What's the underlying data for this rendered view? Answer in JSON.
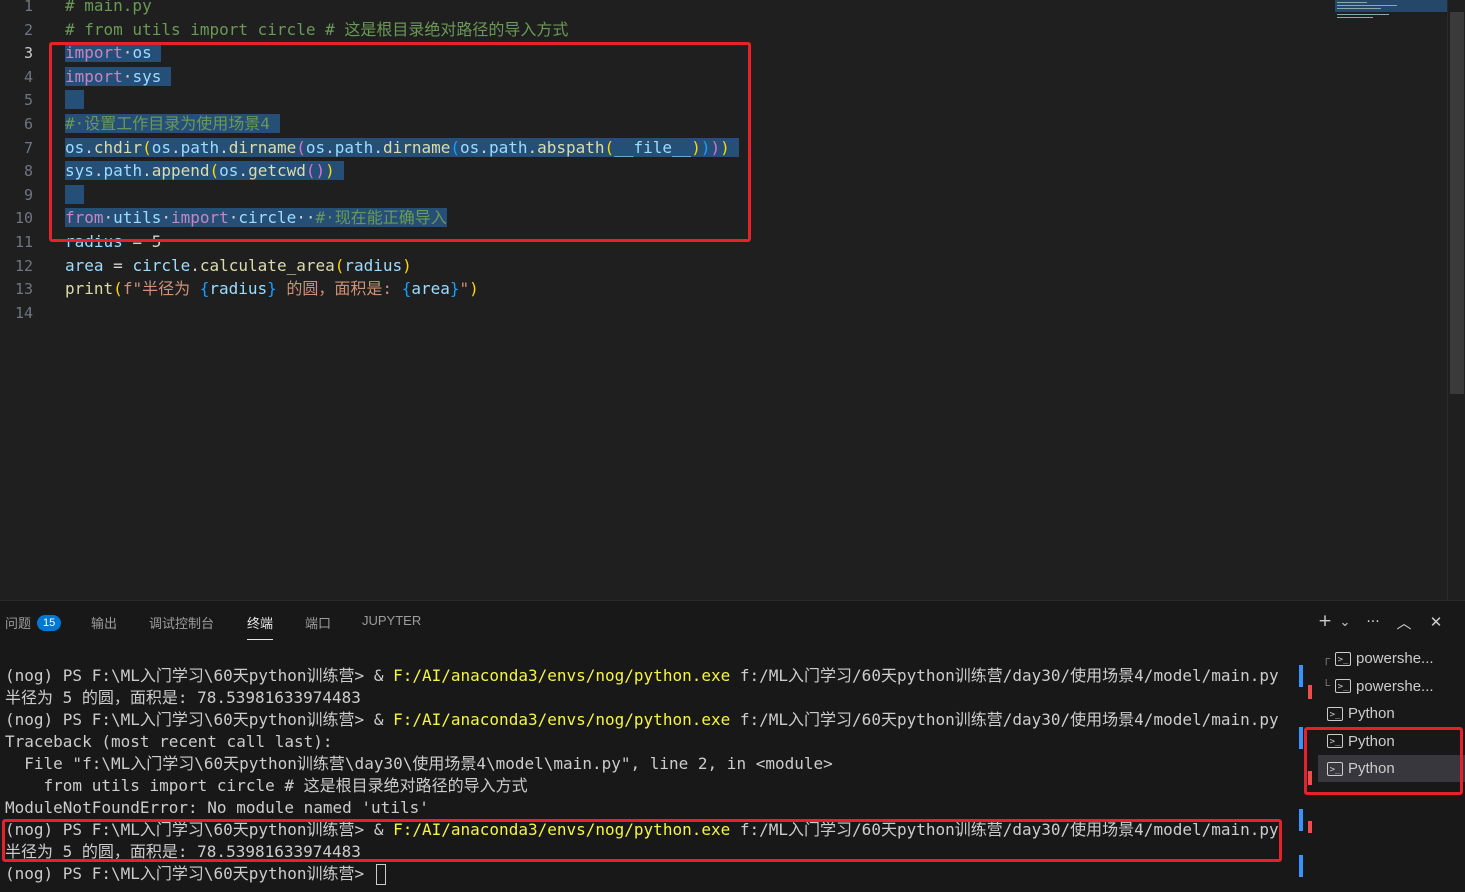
{
  "editor": {
    "lines": [
      {
        "n": "1",
        "segs": [
          {
            "t": "# main.py",
            "c": "com"
          }
        ]
      },
      {
        "n": "2",
        "segs": [
          {
            "t": "# from utils import circle # 这是根目录绝对路径的导入方式",
            "c": "com"
          }
        ]
      },
      {
        "n": "3",
        "cur": true,
        "sel": true,
        "segs": [
          {
            "t": "import",
            "c": "kw"
          },
          {
            "t": "·",
            "c": "ws"
          },
          {
            "t": "os",
            "c": "var"
          },
          {
            "t": " ",
            "c": "plain"
          }
        ]
      },
      {
        "n": "4",
        "sel": true,
        "segs": [
          {
            "t": "import",
            "c": "kw"
          },
          {
            "t": "·",
            "c": "ws"
          },
          {
            "t": "sys",
            "c": "var"
          },
          {
            "t": " ",
            "c": "plain"
          }
        ]
      },
      {
        "n": "5",
        "sel": true,
        "segs": [
          {
            "t": "  ",
            "c": "plain"
          }
        ]
      },
      {
        "n": "6",
        "sel": true,
        "segs": [
          {
            "t": "#·设置工作目录为使用场景4",
            "c": "com"
          },
          {
            "t": " ",
            "c": "plain"
          }
        ]
      },
      {
        "n": "7",
        "sel": true,
        "segs": [
          {
            "t": "os",
            "c": "var"
          },
          {
            "t": ".",
            "c": "plain"
          },
          {
            "t": "chdir",
            "c": "fn"
          },
          {
            "t": "(",
            "c": "br1"
          },
          {
            "t": "os",
            "c": "var"
          },
          {
            "t": ".",
            "c": "plain"
          },
          {
            "t": "path",
            "c": "var"
          },
          {
            "t": ".",
            "c": "plain"
          },
          {
            "t": "dirname",
            "c": "fn"
          },
          {
            "t": "(",
            "c": "br2"
          },
          {
            "t": "os",
            "c": "var"
          },
          {
            "t": ".",
            "c": "plain"
          },
          {
            "t": "path",
            "c": "var"
          },
          {
            "t": ".",
            "c": "plain"
          },
          {
            "t": "dirname",
            "c": "fn"
          },
          {
            "t": "(",
            "c": "br3"
          },
          {
            "t": "os",
            "c": "var"
          },
          {
            "t": ".",
            "c": "plain"
          },
          {
            "t": "path",
            "c": "var"
          },
          {
            "t": ".",
            "c": "plain"
          },
          {
            "t": "abspath",
            "c": "fn"
          },
          {
            "t": "(",
            "c": "br1"
          },
          {
            "t": "__file__",
            "c": "var"
          },
          {
            "t": ")",
            "c": "br1"
          },
          {
            "t": ")",
            "c": "br3"
          },
          {
            "t": ")",
            "c": "br2"
          },
          {
            "t": ")",
            "c": "br1"
          },
          {
            "t": " ",
            "c": "plain"
          }
        ]
      },
      {
        "n": "8",
        "sel": true,
        "segs": [
          {
            "t": "sys",
            "c": "var"
          },
          {
            "t": ".",
            "c": "plain"
          },
          {
            "t": "path",
            "c": "var"
          },
          {
            "t": ".",
            "c": "plain"
          },
          {
            "t": "append",
            "c": "fn"
          },
          {
            "t": "(",
            "c": "br1"
          },
          {
            "t": "os",
            "c": "var"
          },
          {
            "t": ".",
            "c": "plain"
          },
          {
            "t": "getcwd",
            "c": "fn"
          },
          {
            "t": "(",
            "c": "br2"
          },
          {
            "t": ")",
            "c": "br2"
          },
          {
            "t": ")",
            "c": "br1"
          },
          {
            "t": " ",
            "c": "plain"
          }
        ]
      },
      {
        "n": "9",
        "sel": true,
        "segs": [
          {
            "t": "  ",
            "c": "plain"
          }
        ]
      },
      {
        "n": "10",
        "sel": true,
        "segs": [
          {
            "t": "from",
            "c": "kw"
          },
          {
            "t": "·",
            "c": "ws"
          },
          {
            "t": "utils",
            "c": "var"
          },
          {
            "t": "·",
            "c": "ws"
          },
          {
            "t": "import",
            "c": "kw"
          },
          {
            "t": "·",
            "c": "ws"
          },
          {
            "t": "circle",
            "c": "var"
          },
          {
            "t": "··",
            "c": "ws"
          },
          {
            "t": "#·现在能正确导入",
            "c": "com"
          }
        ]
      },
      {
        "n": "11",
        "segs": [
          {
            "t": "radius",
            "c": "var"
          },
          {
            "t": " = ",
            "c": "plain"
          },
          {
            "t": "5",
            "c": "plain"
          }
        ]
      },
      {
        "n": "12",
        "segs": [
          {
            "t": "area",
            "c": "var"
          },
          {
            "t": " = ",
            "c": "plain"
          },
          {
            "t": "circle",
            "c": "var"
          },
          {
            "t": ".",
            "c": "plain"
          },
          {
            "t": "calculate_area",
            "c": "fn"
          },
          {
            "t": "(",
            "c": "br1"
          },
          {
            "t": "radius",
            "c": "var"
          },
          {
            "t": ")",
            "c": "br1"
          }
        ]
      },
      {
        "n": "13",
        "segs": [
          {
            "t": "print",
            "c": "fn"
          },
          {
            "t": "(",
            "c": "br1"
          },
          {
            "t": "f\"半径为 ",
            "c": "str"
          },
          {
            "t": "{",
            "c": "br3"
          },
          {
            "t": "radius",
            "c": "var"
          },
          {
            "t": "}",
            "c": "br3"
          },
          {
            "t": " 的圆，面积是: ",
            "c": "str"
          },
          {
            "t": "{",
            "c": "br3"
          },
          {
            "t": "area",
            "c": "var"
          },
          {
            "t": "}",
            "c": "br3"
          },
          {
            "t": "\"",
            "c": "str"
          },
          {
            "t": ")",
            "c": "br1"
          }
        ]
      },
      {
        "n": "14",
        "segs": []
      }
    ]
  },
  "panel": {
    "tabs": [
      {
        "label": "问题",
        "badge": "15"
      },
      {
        "label": "输出"
      },
      {
        "label": "调试控制台"
      },
      {
        "label": "终端",
        "active": true
      },
      {
        "label": "端口"
      },
      {
        "label": "JUPYTER"
      }
    ],
    "tools": {
      "add": "+",
      "dropdown": "⌄",
      "more": "···",
      "maximize": "︿",
      "close": "✕"
    },
    "terminal_lines": [
      {
        "segs": [
          {
            "t": "(nog) PS F:\\ML入门学习\\60天python训练营> & "
          },
          {
            "t": "F:/AI/anaconda3/envs/nog/python.exe",
            "c": "yel"
          },
          {
            "t": " f:/ML入门学习/60天python训练营/day30/使用场景4/model/main.py"
          }
        ]
      },
      {
        "segs": [
          {
            "t": "半径为 5 的圆，面积是: 78.53981633974483"
          }
        ]
      },
      {
        "segs": [
          {
            "t": "(nog) PS F:\\ML入门学习\\60天python训练营> & "
          },
          {
            "t": "F:/AI/anaconda3/envs/nog/python.exe",
            "c": "yel"
          },
          {
            "t": " f:/ML入门学习/60天python训练营/day30/使用场景4/model/main.py"
          }
        ]
      },
      {
        "segs": [
          {
            "t": "Traceback (most recent call last):"
          }
        ]
      },
      {
        "segs": [
          {
            "t": "  File \"f:\\ML入门学习\\60天python训练营\\day30\\使用场景4\\model\\main.py\", line 2, in <module>"
          }
        ]
      },
      {
        "segs": [
          {
            "t": "    from utils import circle # 这是根目录绝对路径的导入方式"
          }
        ]
      },
      {
        "segs": [
          {
            "t": "ModuleNotFoundError: No module named 'utils'"
          }
        ]
      },
      {
        "segs": [
          {
            "t": "(nog) PS F:\\ML入门学习\\60天python训练营> & "
          },
          {
            "t": "F:/AI/anaconda3/envs/nog/python.exe",
            "c": "yel"
          },
          {
            "t": " f:/ML入门学习/60天python训练营/day30/使用场景4/model/main.py"
          }
        ]
      },
      {
        "segs": [
          {
            "t": "半径为 5 的圆，面积是: 78.53981633974483"
          }
        ]
      },
      {
        "segs": [
          {
            "t": "(nog) PS F:\\ML入门学习\\60天python训练营> "
          }
        ],
        "cursor": true
      }
    ],
    "terminal_list": [
      {
        "tree": "┌",
        "label": "powershe..."
      },
      {
        "tree": "└",
        "label": "powershe..."
      },
      {
        "tree": "",
        "label": "Python"
      },
      {
        "tree": "",
        "label": "Python"
      },
      {
        "tree": "",
        "label": "Python",
        "active": true
      }
    ]
  },
  "colors": {
    "highlight_box": "#e8202a",
    "selection": "#264f78",
    "accent": "#0078d4"
  }
}
